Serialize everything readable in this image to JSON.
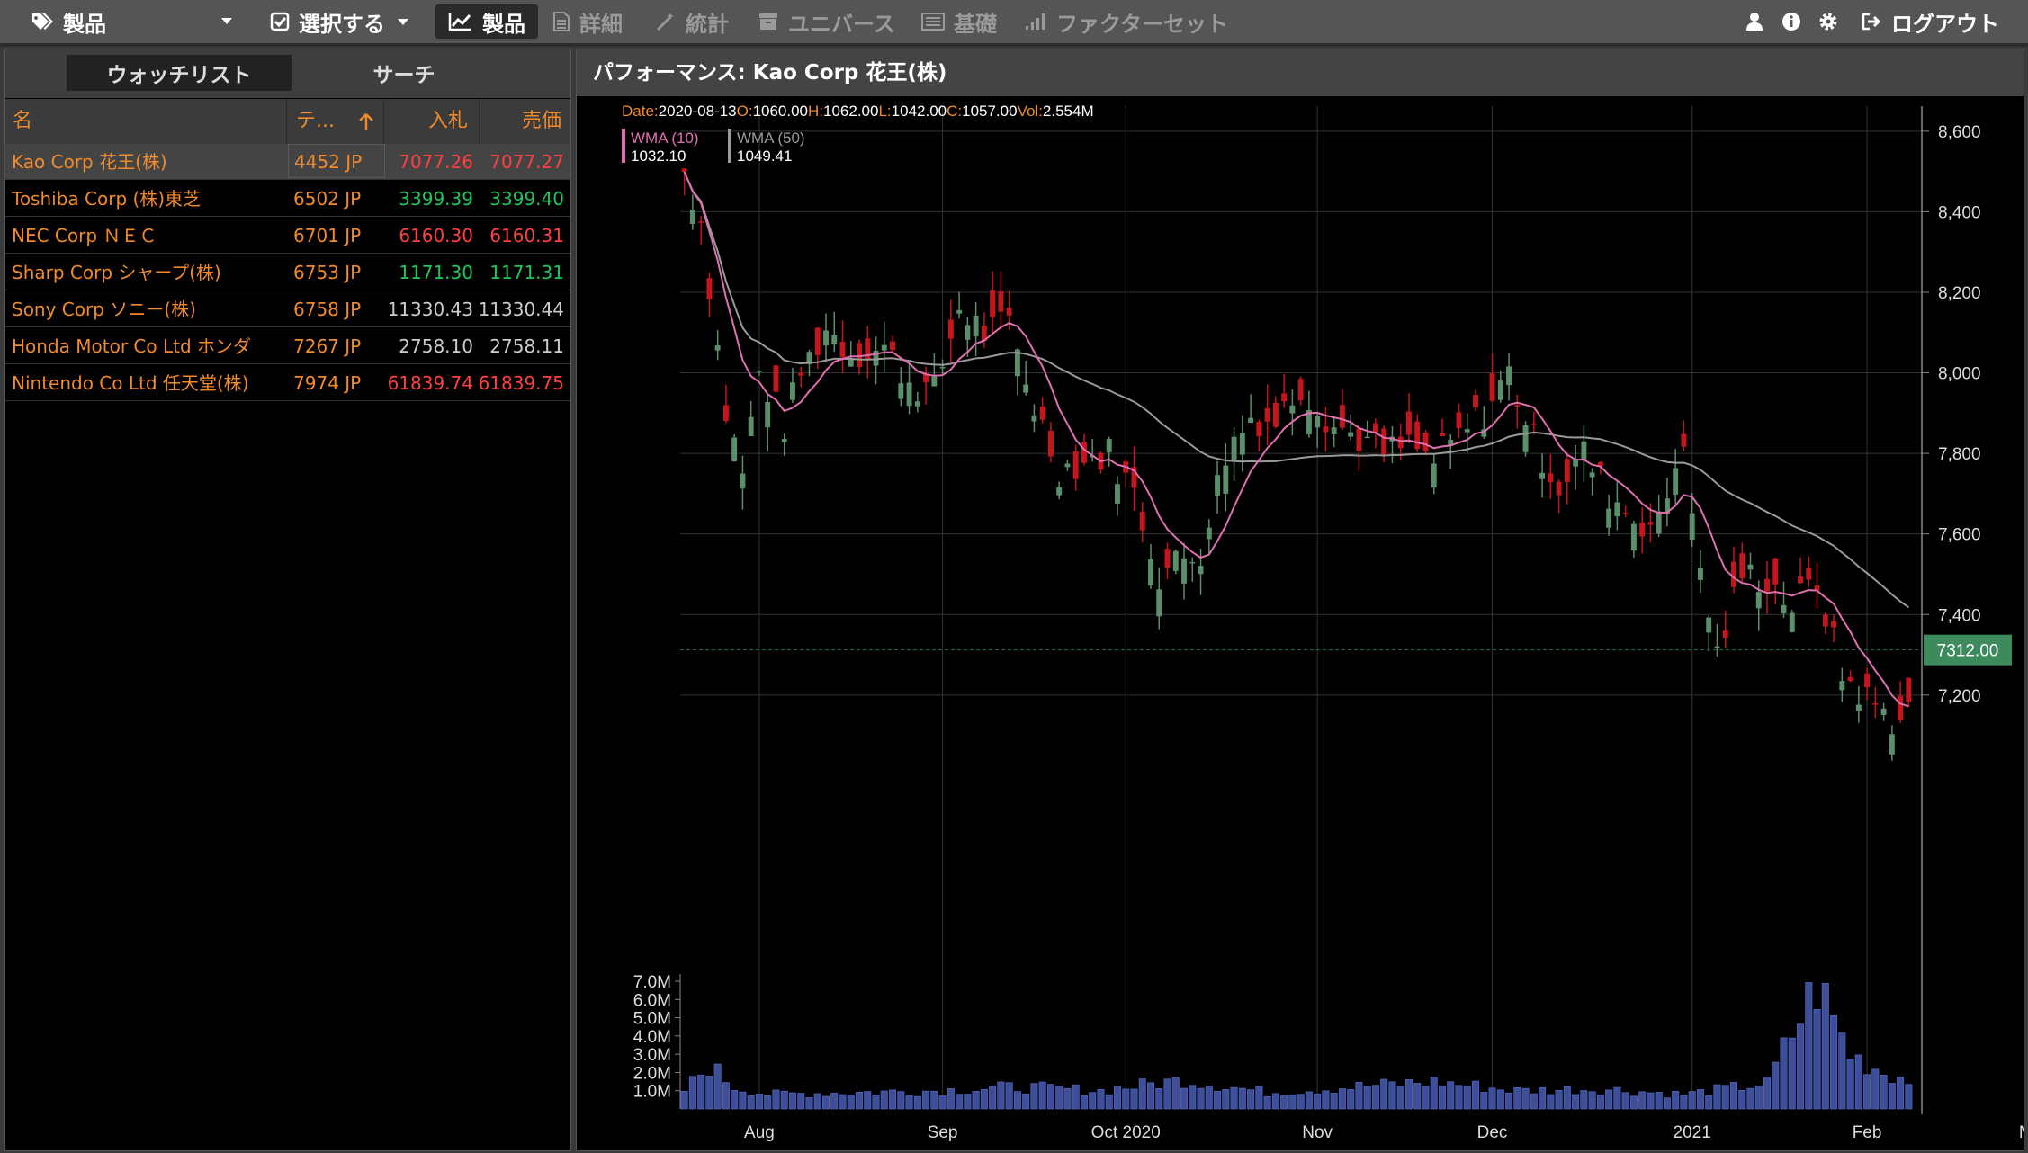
{
  "topbar": {
    "items": [
      {
        "label": "製品",
        "icon": "tags-icon"
      },
      {
        "label": "選択する",
        "icon": "check-square-icon"
      },
      {
        "label": "製品",
        "icon": "line-chart-icon"
      },
      {
        "label": "詳細",
        "icon": "document-icon"
      },
      {
        "label": "統計",
        "icon": "magic-wand-icon"
      },
      {
        "label": "ユニバース",
        "icon": "archive-icon"
      },
      {
        "label": "基礎",
        "icon": "list-icon"
      },
      {
        "label": "ファクターセット",
        "icon": "bar-chart-icon"
      }
    ],
    "logout_label": "ログアウト"
  },
  "left_panel": {
    "tabs": [
      "ウォッチリスト",
      "サーチ"
    ],
    "columns": [
      "名",
      "テ...",
      "入札",
      "売価"
    ],
    "rows": [
      {
        "name": "Kao Corp 花王(株)",
        "ticker": "4452 JP",
        "bid": "7077.26",
        "ask": "7077.27",
        "color": "#ff4040"
      },
      {
        "name": "Toshiba Corp (株)東芝",
        "ticker": "6502 JP",
        "bid": "3399.39",
        "ask": "3399.40",
        "color": "#21c55d"
      },
      {
        "name": "NEC Corp ＮＥＣ",
        "ticker": "6701 JP",
        "bid": "6160.30",
        "ask": "6160.31",
        "color": "#ff4040"
      },
      {
        "name": "Sharp Corp シャープ(株)",
        "ticker": "6753 JP",
        "bid": "1171.30",
        "ask": "1171.31",
        "color": "#21c55d"
      },
      {
        "name": "Sony Corp ソニー(株)",
        "ticker": "6758 JP",
        "bid": "11330.43",
        "ask": "11330.44",
        "color": "#cccccc"
      },
      {
        "name": "Honda Motor Co Ltd ホンダ",
        "ticker": "7267 JP",
        "bid": "2758.10",
        "ask": "2758.11",
        "color": "#cccccc"
      },
      {
        "name": "Nintendo Co Ltd 任天堂(株)",
        "ticker": "7974 JP",
        "bid": "61839.74",
        "ask": "61839.75",
        "color": "#ff4040"
      }
    ]
  },
  "right_panel": {
    "title": "パフォーマンス:  Kao Corp 花王(株)"
  },
  "chart_data": {
    "type": "candlestick",
    "info": {
      "date_label": "Date:",
      "date": "2020-08-13",
      "o_label": "O:",
      "o": "1060.00",
      "h_label": "H:",
      "h": "1062.00",
      "l_label": "L:",
      "l": "1042.00",
      "c_label": "C:",
      "c": "1057.00",
      "vol_label": "Vol:",
      "vol": "2.554M"
    },
    "legend": [
      {
        "name": "WMA (10)",
        "value": "1032.10",
        "color": "#e070b0"
      },
      {
        "name": "WMA (50)",
        "value": "1049.41",
        "color": "#9a9a9a"
      }
    ],
    "y_ticks": [
      8600,
      8400,
      8200,
      8000,
      7800,
      7600,
      7400,
      7200
    ],
    "y_tick_labels": [
      "8,600",
      "8,400",
      "8,200",
      "8,000",
      "7,800",
      "7,600",
      "7,400",
      "7,200"
    ],
    "ylim": [
      7050,
      8680
    ],
    "last_price_label": "7312.00",
    "last_price": 7312,
    "vol_ticks": [
      "1.0M",
      "2.0M",
      "3.0M",
      "4.0M",
      "5.0M",
      "6.0M",
      "7.0M"
    ],
    "vol_max": 7.0,
    "x_labels": [
      "Aug",
      "Sep",
      "Oct 2020",
      "Nov",
      "Dec",
      "2021",
      "Feb",
      "Mar"
    ],
    "x_label_index": [
      9,
      31,
      53,
      76,
      97,
      121,
      142,
      162
    ],
    "close_anchors": [
      [
        0,
        8500
      ],
      [
        2,
        8380
      ],
      [
        5,
        7900
      ],
      [
        7,
        7750
      ],
      [
        9,
        8000
      ],
      [
        12,
        7870
      ],
      [
        14,
        8000
      ],
      [
        17,
        8110
      ],
      [
        20,
        8050
      ],
      [
        24,
        8060
      ],
      [
        27,
        7980
      ],
      [
        30,
        7950
      ],
      [
        33,
        8160
      ],
      [
        36,
        8100
      ],
      [
        39,
        8120
      ],
      [
        42,
        7920
      ],
      [
        45,
        7760
      ],
      [
        48,
        7780
      ],
      [
        51,
        7800
      ],
      [
        54,
        7700
      ],
      [
        57,
        7500
      ],
      [
        60,
        7540
      ],
      [
        62,
        7560
      ],
      [
        65,
        7800
      ],
      [
        68,
        7890
      ],
      [
        71,
        7880
      ],
      [
        74,
        7970
      ],
      [
        78,
        7870
      ],
      [
        81,
        7840
      ],
      [
        84,
        7800
      ],
      [
        87,
        7820
      ],
      [
        90,
        7780
      ],
      [
        93,
        7840
      ],
      [
        96,
        7900
      ],
      [
        99,
        8000
      ],
      [
        102,
        7830
      ],
      [
        105,
        7720
      ],
      [
        108,
        7800
      ],
      [
        111,
        7700
      ],
      [
        114,
        7640
      ],
      [
        117,
        7620
      ],
      [
        120,
        7850
      ],
      [
        121,
        7620
      ],
      [
        124,
        7300
      ],
      [
        127,
        7500
      ],
      [
        130,
        7490
      ],
      [
        133,
        7420
      ],
      [
        136,
        7480
      ],
      [
        139,
        7250
      ],
      [
        142,
        7190
      ],
      [
        145,
        7140
      ],
      [
        147,
        7160
      ]
    ],
    "vol_anchors": [
      [
        0,
        1.0
      ],
      [
        3,
        2.4
      ],
      [
        6,
        1.2
      ],
      [
        10,
        0.8
      ],
      [
        20,
        0.9
      ],
      [
        30,
        1.0
      ],
      [
        40,
        1.2
      ],
      [
        50,
        1.0
      ],
      [
        60,
        1.6
      ],
      [
        70,
        0.9
      ],
      [
        80,
        1.2
      ],
      [
        90,
        1.5
      ],
      [
        100,
        1.0
      ],
      [
        110,
        1.1
      ],
      [
        120,
        0.8
      ],
      [
        130,
        1.4
      ],
      [
        136,
        6.8
      ],
      [
        140,
        3.0
      ],
      [
        144,
        2.0
      ],
      [
        147,
        1.6
      ]
    ]
  }
}
